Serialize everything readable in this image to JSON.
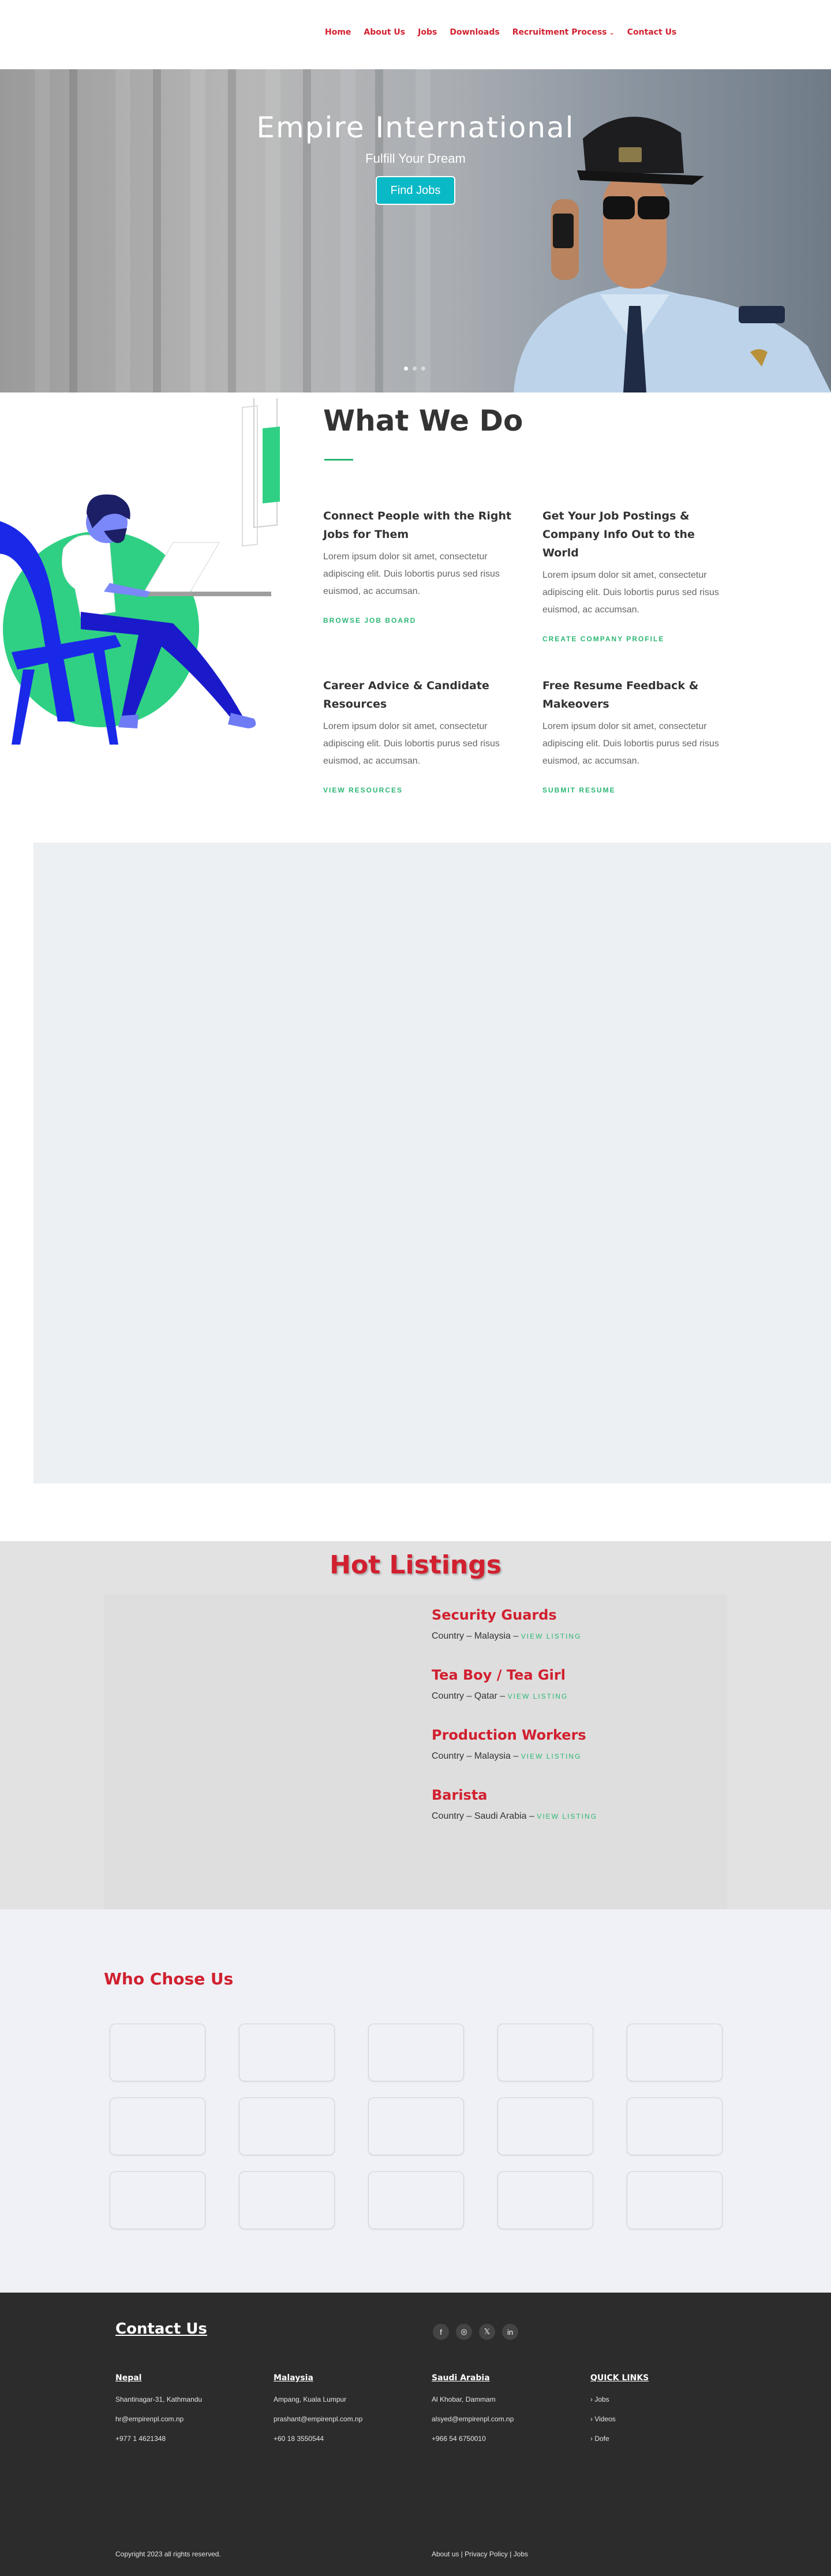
{
  "nav": {
    "items": [
      "Home",
      "About Us",
      "Jobs",
      "Downloads",
      "Recruitment Process",
      "Contact Us"
    ],
    "caret": "⌄"
  },
  "hero": {
    "title": "Empire International",
    "subtitle": "Fulfill Your Dream",
    "button": "Find Jobs",
    "slides": 3,
    "active_slide": 1
  },
  "what_we_do": {
    "title": "What We Do",
    "services": [
      {
        "title": "Connect People with the Right Jobs for Them",
        "text": "Lorem ipsum dolor sit amet, consectetur adipiscing elit. Duis lobortis purus sed risus euismod, ac accumsan.",
        "link": "BROWSE JOB BOARD"
      },
      {
        "title": "Get Your Job Postings & Company Info Out to the World",
        "text": "Lorem ipsum dolor sit amet, consectetur adipiscing elit. Duis lobortis purus sed risus euismod, ac accumsan.",
        "link": "CREATE COMPANY PROFILE"
      },
      {
        "title": "Career Advice & Candidate Resources",
        "text": "Lorem ipsum dolor sit amet, consectetur adipiscing elit. Duis lobortis purus sed risus euismod, ac accumsan.",
        "link": "VIEW RESOURCES"
      },
      {
        "title": "Free Resume  Feedback & Makeovers",
        "text": "Lorem ipsum dolor sit amet, consectetur adipiscing elit. Duis lobortis purus sed risus euismod, ac accumsan.",
        "link": "SUBMIT RESUME"
      }
    ]
  },
  "hot_listings": {
    "title": "Hot Listings",
    "view_label": "VIEW LISTING",
    "items": [
      {
        "title": "Security Guards",
        "country": "Country – Malaysia –"
      },
      {
        "title": "Tea Boy / Tea Girl",
        "country": "Country – Qatar –"
      },
      {
        "title": "Production Workers",
        "country": "Country – Malaysia –"
      },
      {
        "title": "Barista",
        "country": "Country – Saudi Arabia –"
      }
    ]
  },
  "who_chose_us": {
    "title": "Who Chose Us",
    "logo_count": 15
  },
  "footer": {
    "contact_title": "Contact Us",
    "socials": [
      "f",
      "◎",
      "𝕏",
      "in"
    ],
    "social_icons": [
      "facebook-icon",
      "instagram-icon",
      "x-icon",
      "linkedin-icon"
    ],
    "offices": [
      {
        "country": "Nepal",
        "address": "Shantinagar-31, Kathmandu",
        "email": "hr@empirenpl.com.np",
        "phone": "+977 1 4621348"
      },
      {
        "country": "Malaysia",
        "address": "Ampang, Kuala Lumpur",
        "email": "prashant@empirenpl.com.np",
        "phone": "+60 18 3550544"
      },
      {
        "country": "Saudi Arabia",
        "address": "Al Khobar, Dammam",
        "email": "alsyed@empirenpl.com.np",
        "phone": "+966 54 6750010"
      }
    ],
    "quick_links": {
      "title": "QUICK LINKS",
      "items": [
        "› Jobs",
        "› Videos",
        "› Dofe"
      ]
    },
    "copyright": "Copyright 2023 all rights reserved.",
    "bottom_links": [
      "About us",
      "Privacy Policy",
      "Jobs"
    ],
    "separator": " | "
  },
  "colors": {
    "brand_red": "#d1202f",
    "accent_green": "#2bb673",
    "hero_button": "#0ab9c6",
    "footer_bg": "#2c2c2c"
  }
}
